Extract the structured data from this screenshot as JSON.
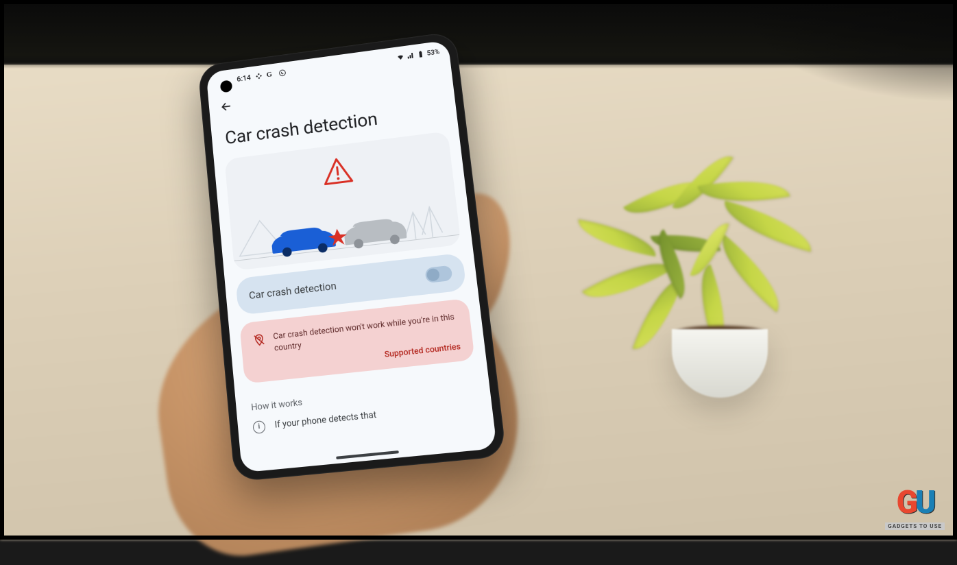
{
  "status": {
    "time": "6:14",
    "battery_text": "53%"
  },
  "page": {
    "title": "Car crash detection"
  },
  "toggle": {
    "label": "Car crash detection",
    "enabled": false
  },
  "warning": {
    "message": "Car crash detection won't work while you're in this country",
    "link_label": "Supported countries"
  },
  "section": {
    "title": "How it works",
    "row_text": "If your phone detects that"
  },
  "watermark": {
    "logo_g": "G",
    "logo_u": "U",
    "tagline": "GADGETS TO USE"
  }
}
